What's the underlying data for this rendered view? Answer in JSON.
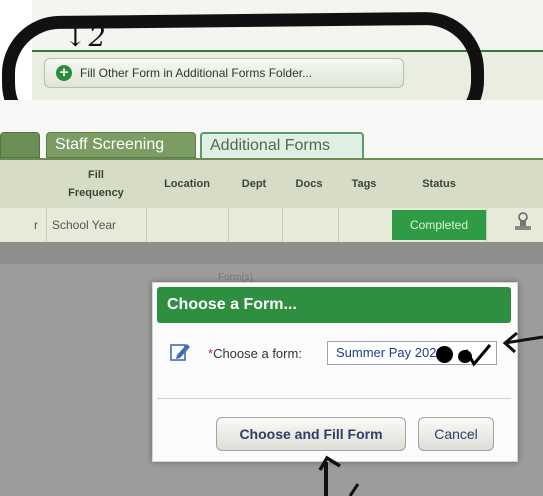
{
  "annotations": {
    "top_note": "↓2"
  },
  "toolbar": {
    "fill_other_label": "Fill Other Form in Additional Forms Folder..."
  },
  "tabs": [
    {
      "label": ""
    },
    {
      "label": "Staff Screening"
    },
    {
      "label": "Additional Forms"
    }
  ],
  "table": {
    "columns": [
      "Fill Frequency",
      "Location",
      "Dept",
      "Docs",
      "Tags",
      "Status"
    ],
    "rows": [
      {
        "partial": "r",
        "fill_frequency": "School Year",
        "location": "",
        "dept": "",
        "docs": "",
        "tags": "",
        "status": "Completed"
      }
    ]
  },
  "background": {
    "faded_text": "Form(s)"
  },
  "modal": {
    "title": "Choose a Form...",
    "field_label": "Choose a form:",
    "required_mark": "*",
    "selected_value": "Summer Pay 2023",
    "primary_button": "Choose and Fill Form",
    "cancel_button": "Cancel"
  },
  "colors": {
    "accent_green": "#2e8f41",
    "status_green": "#2f9b45",
    "link_blue": "#1d3d86"
  },
  "icons": [
    "plus-circle-icon",
    "edit-form-icon",
    "stamp-icon",
    "chevron-down-icon"
  ]
}
